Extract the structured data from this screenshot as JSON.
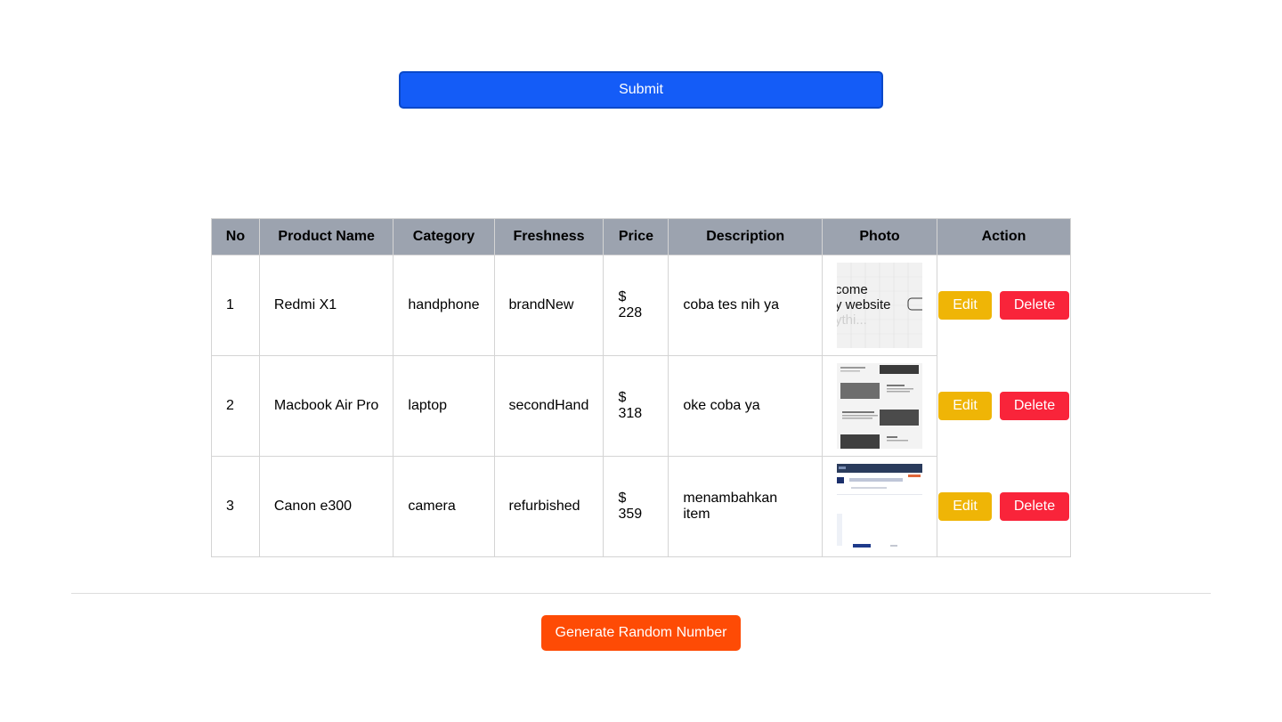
{
  "form": {
    "submit_label": "Submit"
  },
  "table": {
    "headers": [
      "No",
      "Product Name",
      "Category",
      "Freshness",
      "Price",
      "Description",
      "Photo",
      "Action"
    ],
    "rows": [
      {
        "no": "1",
        "name": "Redmi X1",
        "category": "handphone",
        "freshness": "brandNew",
        "price": "$ 228",
        "description": "coba tes nih ya",
        "photo_text": [
          "come",
          "y website",
          "ythi..."
        ],
        "edit": "Edit",
        "delete": "Delete"
      },
      {
        "no": "2",
        "name": "Macbook Air Pro",
        "category": "laptop",
        "freshness": "secondHand",
        "price": "$ 318",
        "description": "oke coba ya",
        "edit": "Edit",
        "delete": "Delete"
      },
      {
        "no": "3",
        "name": "Canon e300",
        "category": "camera",
        "freshness": "refurbished",
        "price": "$ 359",
        "description": "menambahkan item",
        "edit": "Edit",
        "delete": "Delete"
      }
    ]
  },
  "footer": {
    "random_label": "Generate Random Number"
  },
  "colors": {
    "submit": "#145cf7",
    "header_bg": "#9ca3af",
    "edit": "#efb506",
    "delete": "#f9243a",
    "random": "#fe4b05"
  }
}
